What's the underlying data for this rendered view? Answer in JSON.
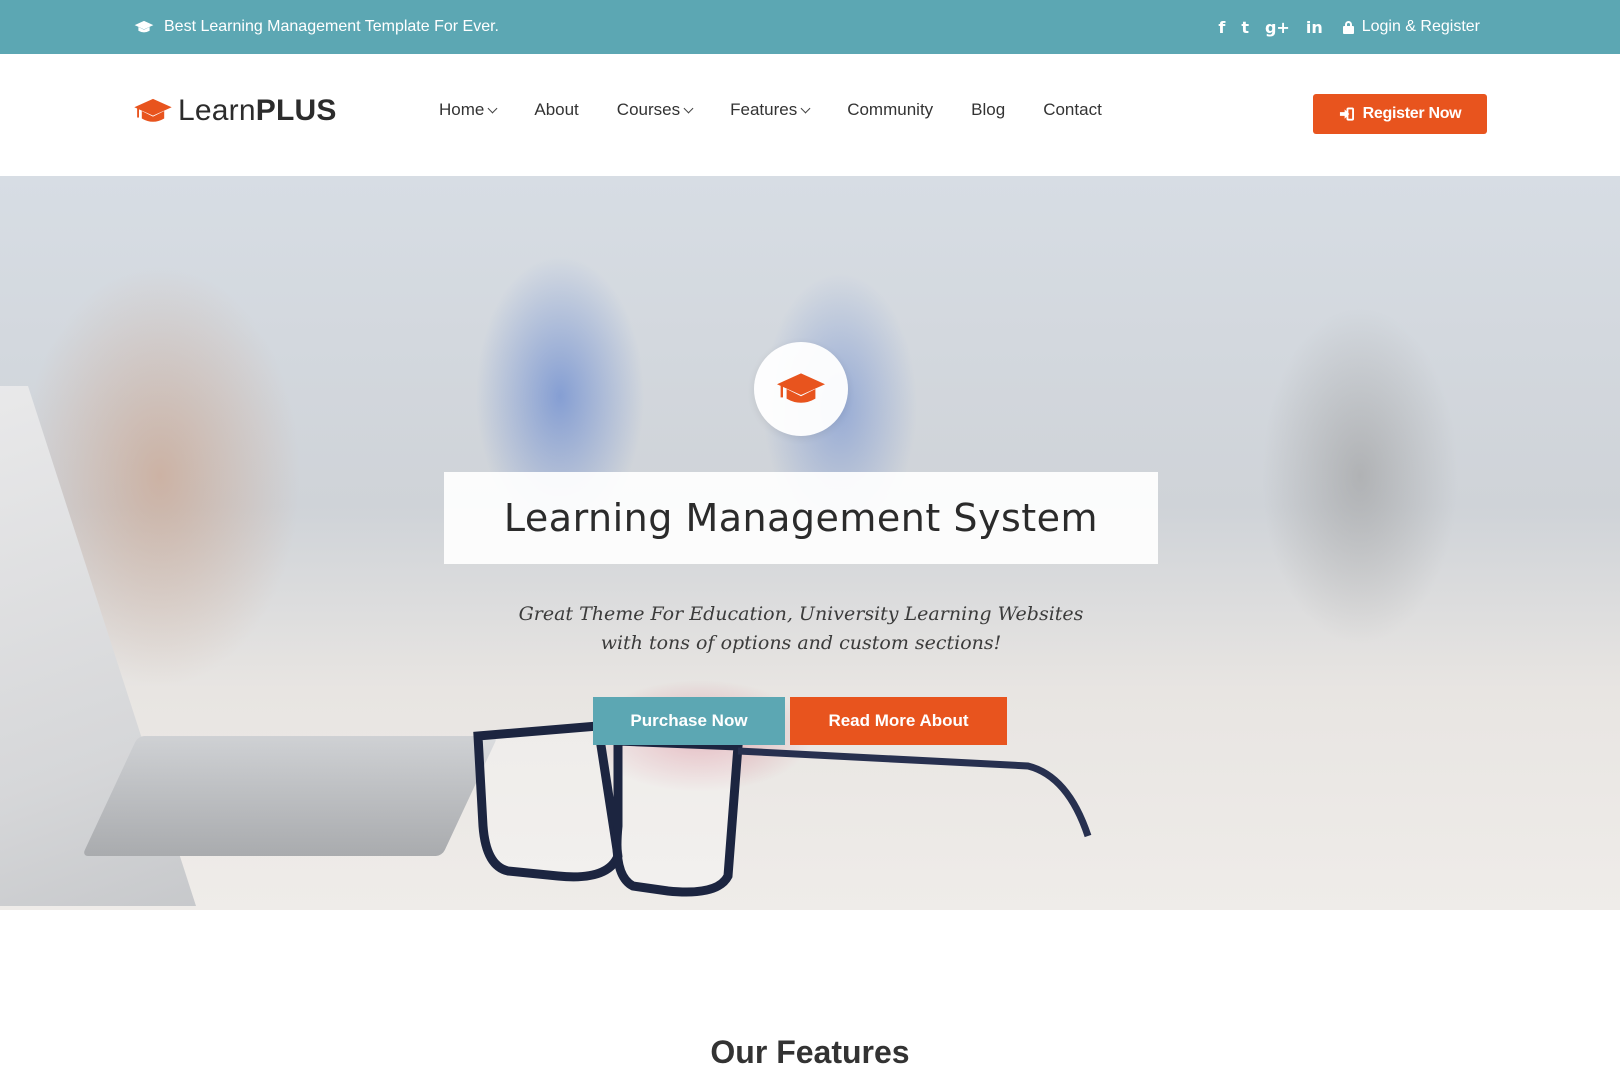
{
  "topbar": {
    "tagline": "Best Learning Management Template For Ever.",
    "social": {
      "facebook": "f",
      "twitter": "t",
      "googleplus": "g+",
      "linkedin": "in"
    },
    "login_label": "Login & Register"
  },
  "header": {
    "logo_light": "Learn",
    "logo_bold": "PLUS",
    "nav": [
      {
        "label": "Home",
        "dropdown": true
      },
      {
        "label": "About",
        "dropdown": false
      },
      {
        "label": "Courses",
        "dropdown": true
      },
      {
        "label": "Features",
        "dropdown": true
      },
      {
        "label": "Community",
        "dropdown": false
      },
      {
        "label": "Blog",
        "dropdown": false
      },
      {
        "label": "Contact",
        "dropdown": false
      }
    ],
    "register_label": "Register Now"
  },
  "hero": {
    "title": "Learning Management System",
    "subtitle_line1": "Great Theme For Education, University Learning Websites",
    "subtitle_line2": "with tons of options and custom sections!",
    "purchase_label": "Purchase Now",
    "read_more_label": "Read More About"
  },
  "features": {
    "title": "Our Features"
  },
  "colors": {
    "teal": "#5ca7b3",
    "orange": "#e8541e"
  },
  "icons": {
    "cap": "graduation-cap-icon",
    "lock": "lock-icon",
    "signin": "sign-in-icon"
  }
}
